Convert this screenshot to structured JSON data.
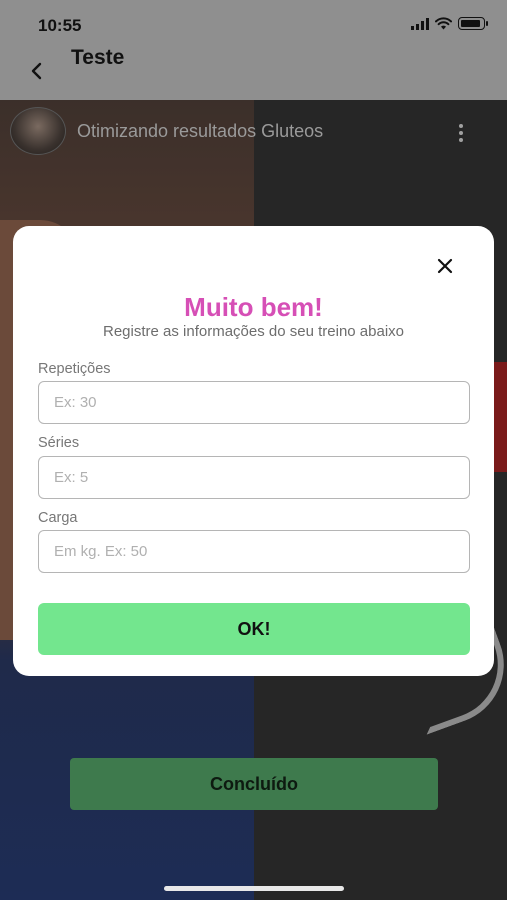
{
  "status_bar": {
    "time": "10:55"
  },
  "header": {
    "title": "Teste"
  },
  "video": {
    "title": "Otimizando resultados Gluteos"
  },
  "modal": {
    "title": "Muito bem!",
    "subtitle": "Registre as informações do seu treino abaixo",
    "fields": [
      {
        "label": "Repetições",
        "placeholder": "Ex: 30",
        "value": ""
      },
      {
        "label": "Séries",
        "placeholder": "Ex: 5",
        "value": ""
      },
      {
        "label": "Carga",
        "placeholder": "Em kg. Ex: 50",
        "value": ""
      }
    ],
    "ok_label": "OK!"
  },
  "footer": {
    "concluido_label": "Concluído"
  },
  "colors": {
    "accent_title": "#d64fb6",
    "ok_button": "#73e68e",
    "concluido_button": "#3e7a4d"
  },
  "icons": [
    "back-arrow-icon",
    "more-vertical-icon",
    "close-icon",
    "signal-icon",
    "wifi-icon",
    "battery-icon"
  ]
}
